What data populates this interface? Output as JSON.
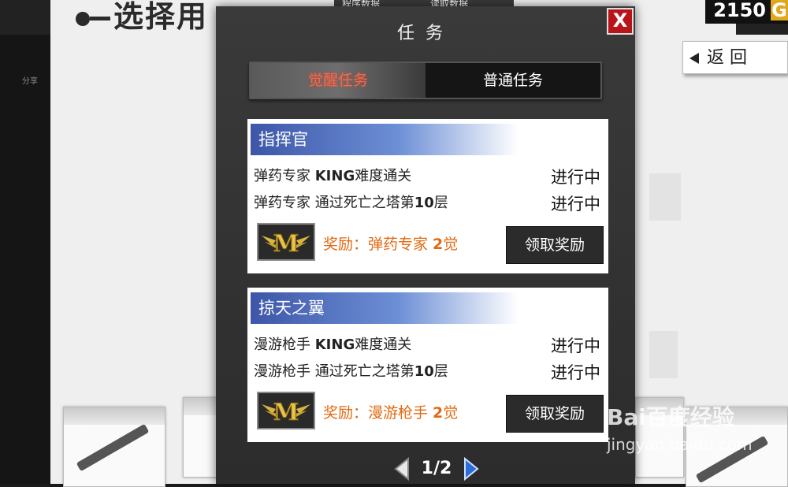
{
  "background": {
    "title": "选择用",
    "tab_buttons": [
      "程序数据",
      "读取数据"
    ],
    "gold": "2150",
    "gold_icon": "G",
    "back_label": "返  回",
    "left_column_text": [
      "分享"
    ]
  },
  "modal": {
    "title": "任务",
    "close_label": "X",
    "tabs": [
      {
        "label": "觉醒任务",
        "active": true
      },
      {
        "label": "普通任务",
        "active": false
      }
    ],
    "tasks": [
      {
        "name": "指挥官",
        "objectives": [
          {
            "prefix": "弹药专家 ",
            "bold": "KING",
            "suffix": "难度通关",
            "status": "进行中"
          },
          {
            "prefix": "弹药专家 通过死亡之塔第",
            "bold": "10",
            "suffix": "层",
            "status": "进行中"
          }
        ],
        "reward_prefix": "奖励：弹药专家 ",
        "reward_bold": "2",
        "reward_suffix": "觉",
        "claim_label": "领取奖励"
      },
      {
        "name": "掠天之翼",
        "objectives": [
          {
            "prefix": "漫游枪手 ",
            "bold": "KING",
            "suffix": "难度通关",
            "status": "进行中"
          },
          {
            "prefix": "漫游枪手 通过死亡之塔第",
            "bold": "10",
            "suffix": "层",
            "status": "进行中"
          }
        ],
        "reward_prefix": "奖励：漫游枪手 ",
        "reward_bold": "2",
        "reward_suffix": "觉",
        "claim_label": "领取奖励"
      }
    ],
    "pager": {
      "current": 1,
      "total": 2,
      "text": "1/2"
    }
  },
  "watermark": {
    "brand": "Bai百度经验",
    "url": "jingyan.baidu.com"
  },
  "colors": {
    "accent_red": "#b8151b",
    "active_tab_text": "#f06a4a",
    "reward_text": "#e06a12",
    "header_blue": "#3d56a8",
    "pager_arrow": "#2a6fd6"
  },
  "icons": [
    "close-icon",
    "back-arrow-icon",
    "m-wings-badge-icon",
    "prev-page-icon",
    "next-page-icon",
    "gold-coin-icon"
  ]
}
